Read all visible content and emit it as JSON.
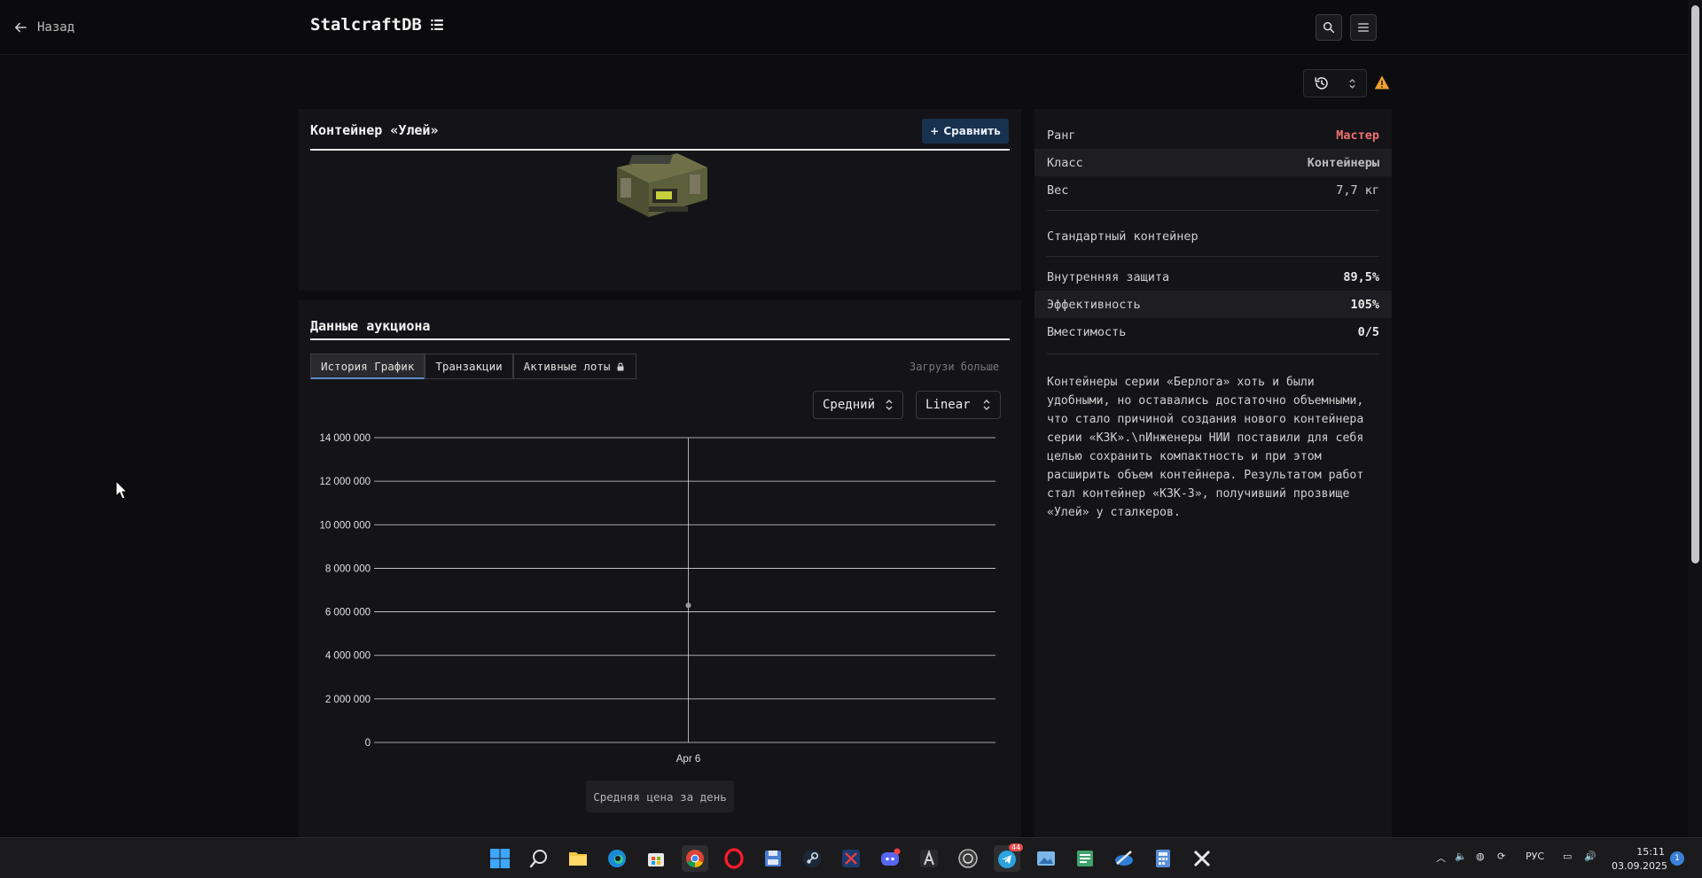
{
  "header": {
    "back_label": "Назад",
    "brand": "StalcraftDB"
  },
  "item": {
    "title": "Контейнер «Улей»",
    "compare_label": "Сравнить"
  },
  "auction": {
    "title": "Данные аукциона",
    "tabs": [
      {
        "label": "История График",
        "active": true
      },
      {
        "label": "Транзакции",
        "active": false
      },
      {
        "label": "Активные лоты",
        "active": false,
        "locked": true
      }
    ],
    "load_more": "Загрузи больше",
    "select_mode": "Средний",
    "select_scale": "Linear",
    "legend": "Средняя цена за день"
  },
  "chart_data": {
    "type": "line",
    "x": [
      "Apr 6"
    ],
    "series": [
      {
        "values": [
          6300000
        ]
      }
    ],
    "y_ticks": [
      "14 000 000",
      "12 000 000",
      "10 000 000",
      "8 000 000",
      "6 000 000",
      "4 000 000",
      "2 000 000",
      "0"
    ],
    "ylim": [
      0,
      14000000
    ],
    "grid": true
  },
  "properties": {
    "rank_label": "Ранг",
    "rank_value": "Мастер",
    "rank_color": "#f07070",
    "class_label": "Класс",
    "class_value": "Контейнеры",
    "weight_label": "Вес",
    "weight_value": "7,7 кг",
    "subtitle": "Стандартный контейнер",
    "internal_label": "Внутренняя защита",
    "internal_value": "89,5%",
    "efficiency_label": "Эффективность",
    "efficiency_value": "105%",
    "capacity_label": "Вместимость",
    "capacity_value": "0/5",
    "description": "Контейнеры серии «Берлога» хоть и были удобными, но оставались достаточно объемными, что стало причиной создания нового контейнера серии «КЗК».\\nИнженеры НИИ поставили для себя целью сохранить компактность и при этом расширить объем контейнера. Результатом работ стал контейнер «КЗК-3», получивший прозвище «Улей» у сталкеров."
  },
  "taskbar": {
    "discord_badge": "",
    "telegram_badge": "44",
    "lang": "РУС",
    "time": "15:11",
    "date": "03.09.2025",
    "notifications": "1"
  }
}
